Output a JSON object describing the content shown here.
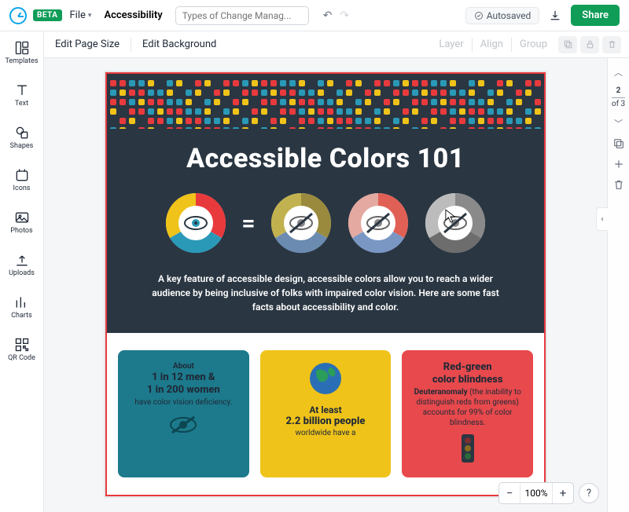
{
  "topbar": {
    "beta": "BETA",
    "file": "File",
    "accessibility": "Accessibility",
    "placeholder": "Types of Change Manag...",
    "autosaved": "Autosaved",
    "share": "Share"
  },
  "secondbar": {
    "edit_page_size": "Edit Page Size",
    "edit_background": "Edit Background",
    "layer": "Layer",
    "align": "Align",
    "group": "Group"
  },
  "leftnav": [
    {
      "key": "templates",
      "label": "Templates"
    },
    {
      "key": "text",
      "label": "Text"
    },
    {
      "key": "shapes",
      "label": "Shapes"
    },
    {
      "key": "icons",
      "label": "Icons"
    },
    {
      "key": "photos",
      "label": "Photos"
    },
    {
      "key": "uploads",
      "label": "Uploads"
    },
    {
      "key": "charts",
      "label": "Charts"
    },
    {
      "key": "qrcode",
      "label": "QR Code"
    }
  ],
  "rail": {
    "page": "2",
    "of": "of 3"
  },
  "zoom": {
    "value": "100%"
  },
  "help": "?",
  "doc": {
    "title": "Accessible Colors 101",
    "desc": "A key feature of accessible design, accessible colors allow you to reach a wider audience by being inclusive of folks with impaired color vision. Here are some fast facts about accessibility and color.",
    "eq": "=",
    "card_teal_l1": "About",
    "card_teal_l2": "1 in 12 men &",
    "card_teal_l3": "1 in 200 women",
    "card_teal_l4": "have color vision deficiency.",
    "card_yel_l1": "At least",
    "card_yel_l2": "2.2 billion people",
    "card_yel_l3": "worldwide have a",
    "card_red_l1": "Red-green",
    "card_red_l2": "color blindness",
    "card_red_b": "Deuteranomaly",
    "card_red_l3": " (the inability to distinguish reds from greens) accounts for 99% of color blindness."
  }
}
